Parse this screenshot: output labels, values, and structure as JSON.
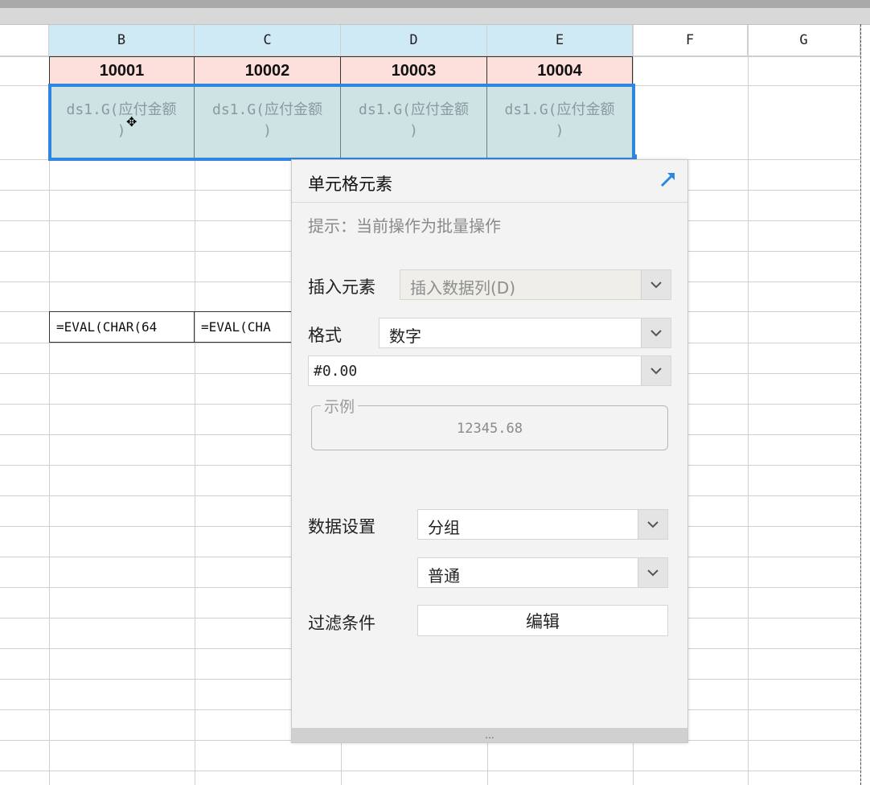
{
  "columns": [
    "B",
    "C",
    "D",
    "E",
    "F",
    "G"
  ],
  "header_row": [
    "10001",
    "10002",
    "10003",
    "10004"
  ],
  "data_cells": [
    "ds1.G(应付金额\n)",
    "ds1.G(应付金额\n)",
    "ds1.G(应付金额\n)",
    "ds1.G(应付金额\n)"
  ],
  "formula_cells": [
    "=EVAL(CHAR(64",
    "=EVAL(CHA"
  ],
  "panel": {
    "title": "单元格元素",
    "hint": "提示：当前操作为批量操作",
    "insert_label": "插入元素",
    "insert_value": "插入数据列(D)",
    "format_label": "格式",
    "format_value": "数字",
    "pattern_value": "#0.00",
    "example_legend": "示例",
    "example_value": "12345.68",
    "data_setting_label": "数据设置",
    "data_setting_value": "分组",
    "group_mode_value": "普通",
    "filter_label": "过滤条件",
    "filter_button": "编辑",
    "footer_grip": "..."
  },
  "colors": {
    "selection": "#2f86e0",
    "header_fill": "#fde0dc",
    "data_fill": "#cde3e4",
    "col_header_selected": "#cfe9f5"
  }
}
